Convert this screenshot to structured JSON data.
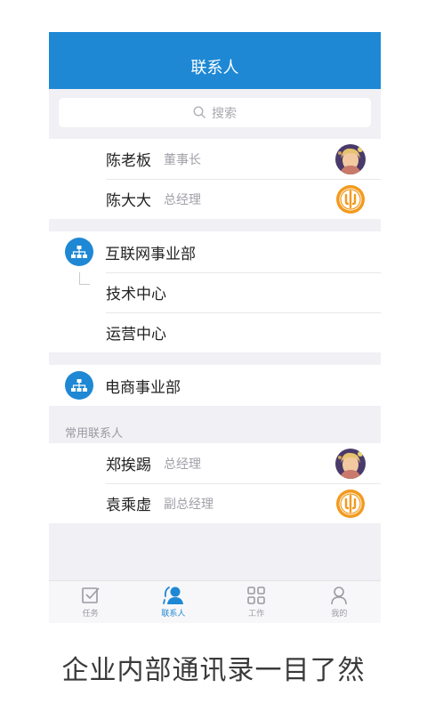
{
  "header": {
    "title": "联系人"
  },
  "search": {
    "placeholder": "搜索"
  },
  "top_contacts": [
    {
      "name": "陈老板",
      "title": "董事长",
      "avatar": "photo"
    },
    {
      "name": "陈大大",
      "title": "总经理",
      "avatar": "logo"
    }
  ],
  "departments": [
    {
      "name": "互联网事业部",
      "children": [
        "技术中心",
        "运营中心"
      ]
    },
    {
      "name": "电商事业部",
      "children": []
    }
  ],
  "frequent": {
    "label": "常用联系人",
    "contacts": [
      {
        "name": "郑挨踢",
        "title": "总经理",
        "avatar": "photo"
      },
      {
        "name": "袁乘虚",
        "title": "副总经理",
        "avatar": "logo"
      }
    ]
  },
  "tabbar": {
    "tabs": [
      {
        "label": "任务",
        "icon": "task-icon",
        "active": false
      },
      {
        "label": "联系人",
        "icon": "contacts-icon",
        "active": true
      },
      {
        "label": "工作",
        "icon": "grid-icon",
        "active": false
      },
      {
        "label": "我的",
        "icon": "profile-icon",
        "active": false
      }
    ]
  },
  "caption": "企业内部通讯录一目了然",
  "colors": {
    "accent": "#1e88d4",
    "background": "#f0f0f5",
    "logo_orange": "#f39a1e"
  }
}
